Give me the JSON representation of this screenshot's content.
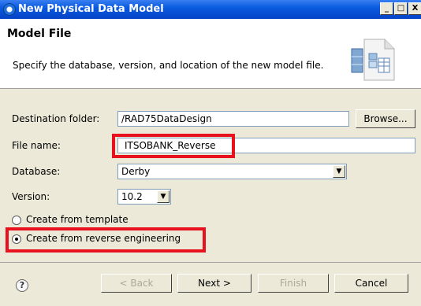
{
  "window": {
    "title": "New Physical Data Model",
    "controls": {
      "minimize": "_",
      "maximize": "□",
      "close": "X"
    }
  },
  "header": {
    "title": "Model File",
    "description": "Specify the database, version, and location of the new model file.",
    "icon": "model-file-wizard-icon"
  },
  "form": {
    "destination_label": "Destination folder:",
    "destination_value": "/RAD75DataDesign",
    "browse_label": "Browse...",
    "filename_label": "File name:",
    "filename_value": "ITSOBANK_Reverse",
    "database_label": "Database:",
    "database_value": "Derby",
    "version_label": "Version:",
    "version_value": "10.2",
    "radio_template_label": "Create from template",
    "radio_reverse_label": "Create from reverse engineering",
    "selected_option": "Create from reverse engineering"
  },
  "buttons": {
    "help": "?",
    "back": "< Back",
    "next": "Next >",
    "finish": "Finish",
    "cancel": "Cancel"
  },
  "colors": {
    "titlebar": "#0a5be0",
    "highlight": "#e8121f",
    "dialog_bg": "#ece9d8"
  }
}
